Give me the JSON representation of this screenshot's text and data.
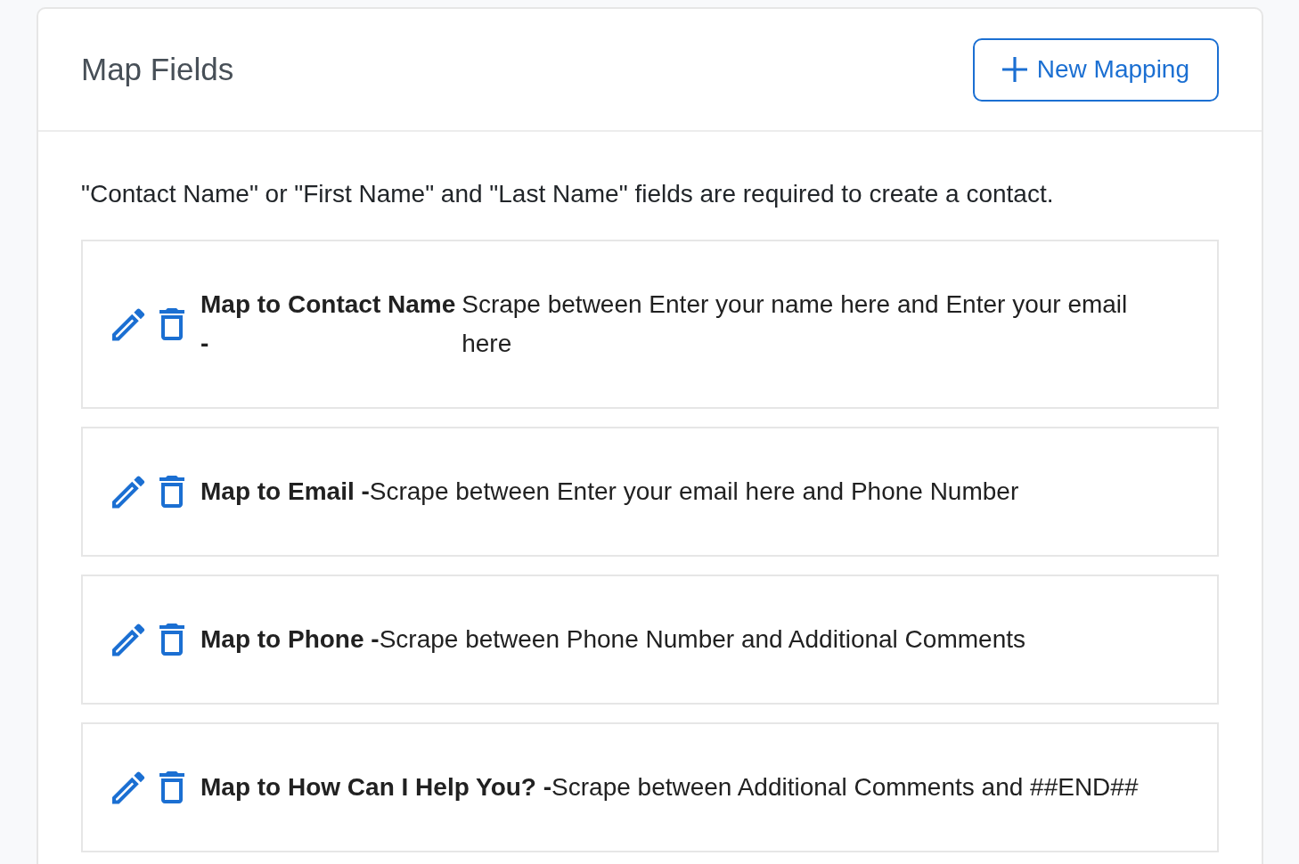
{
  "panel": {
    "title": "Map Fields",
    "new_button": {
      "label": "New Mapping"
    }
  },
  "notice": "\"Contact Name\" or \"First Name\" and \"Last Name\" fields are required to create a contact.",
  "mappings": [
    {
      "title": "Map to Contact Name -",
      "description": "Scrape between Enter your name here and Enter your email here"
    },
    {
      "title": "Map to Email -",
      "description": "Scrape between Enter your email here and Phone Number"
    },
    {
      "title": "Map to Phone -",
      "description": "Scrape between Phone Number and Additional Comments"
    },
    {
      "title": "Map to How Can I Help You? -",
      "description": "Scrape between Additional Comments and ##END##"
    }
  ]
}
